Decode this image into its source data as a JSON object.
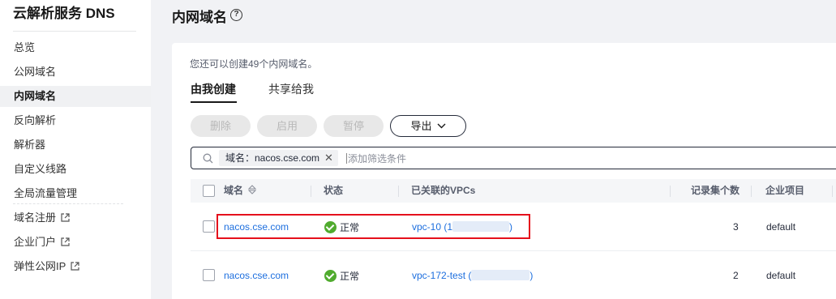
{
  "sidebar": {
    "title": "云解析服务 DNS",
    "items": [
      {
        "label": "总览",
        "external": false
      },
      {
        "label": "公网域名",
        "external": false
      },
      {
        "label": "内网域名",
        "external": false,
        "active": true
      },
      {
        "label": "反向解析",
        "external": false
      },
      {
        "label": "解析器",
        "external": false
      },
      {
        "label": "自定义线路",
        "external": false
      },
      {
        "label": "全局流量管理",
        "external": false
      },
      {
        "label": "域名注册",
        "external": true
      },
      {
        "label": "企业门户",
        "external": true
      },
      {
        "label": "弹性公网IP",
        "external": true
      }
    ]
  },
  "header": {
    "title": "内网域名",
    "help_icon": "?"
  },
  "main": {
    "quota_text": "您还可以创建49个内网域名。",
    "tabs": [
      {
        "label": "由我创建",
        "active": true
      },
      {
        "label": "共享给我",
        "active": false
      }
    ],
    "toolbar": {
      "delete_label": "删除",
      "enable_label": "启用",
      "pause_label": "暂停",
      "export_label": "导出"
    },
    "filter": {
      "tag_label": "域名：nacos.cse.com",
      "placeholder": "添加筛选条件"
    },
    "table": {
      "columns": {
        "domain": "域名",
        "status": "状态",
        "vpcs": "已关联的VPCs",
        "record_count": "记录集个数",
        "enterprise_project": "企业项目"
      },
      "rows": [
        {
          "domain": "nacos.cse.com",
          "status": "正常",
          "vpc_prefix": "vpc-10 (",
          "vpc_lead": "1",
          "vpc_suffix": ")",
          "record_count": "3",
          "enterprise_project": "default",
          "highlighted": true
        },
        {
          "domain": "nacos.cse.com",
          "status": "正常",
          "vpc_prefix": "vpc-172-test (",
          "vpc_lead": "",
          "vpc_suffix": ")",
          "record_count": "2",
          "enterprise_project": "default",
          "highlighted": false
        }
      ]
    }
  },
  "colors": {
    "link": "#1c6ede",
    "status_ok": "#50ab2e",
    "highlight": "#e5101c",
    "text_primary": "#191919"
  },
  "icons": {
    "help": "help-circle-icon",
    "search": "search-icon",
    "external": "external-link-icon",
    "sort": "sort-icon",
    "status_ok": "check-circle-icon",
    "dropdown": "chevron-down-icon",
    "clear": "close-icon"
  }
}
